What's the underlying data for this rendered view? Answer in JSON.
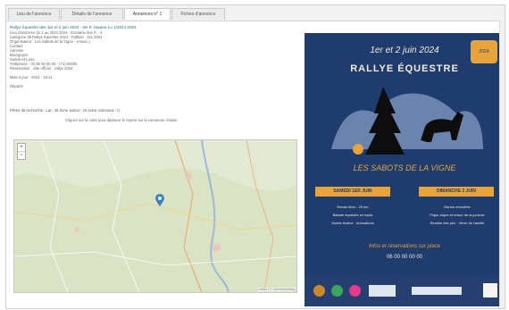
{
  "tabs": [
    {
      "label": "Lieu de l'annonce"
    },
    {
      "label": "Détails de l'annonce"
    },
    {
      "label": "Annonces n° 1"
    },
    {
      "label": "Fiches d'annonce"
    }
  ],
  "info": {
    "head": "Rallye équestre des 1er et 2 juin 2024 - les P. Hautes-Lu 1/2024 2024",
    "lines": [
      "Lieu d'annonce du 1 au 2024 2024 · Domaine des P... 4",
      "Catégorie 09 Rallye Équestre 2024 · Publiée · 111 2024",
      "Organisateur · Les Sabots de la Vigne · (Assoc.)",
      "Contact",
      "Adresse",
      "       Bourgogne",
      "       Saône-et-Loire",
      "Téléphone · 03 85 00 00 00 · (71) 00000",
      "Réservation · Site officiel · rallye 2024",
      "",
      "Mise à jour · 2024 · 18:11"
    ],
    "extra": "Départs"
  },
  "params": {
    "text": "Filtres de recherche :  Lat : 46    Zone autour : 10    Autre commune : 0"
  },
  "note": {
    "text": "Cliquez sur la carte pour déplacer le repère sur la commune choisie"
  },
  "map": {
    "zoom_in": "+",
    "zoom_out": "−",
    "attribution": "Leaflet | © OpenStreetMap"
  },
  "poster": {
    "date_line": "1er et 2 juin 2024",
    "title": "RALLYE ÉQUESTRE",
    "badge": "2024",
    "name": "LES SABOTS DE LA VIGNE",
    "day1": "SAMEDI 1ER JUIN",
    "day2": "DIMANCHE 2 JUIN",
    "d1a": "Rando libre - 25 km",
    "d1b": "Balade équestre et repas",
    "d1c": "Soirée festive · Animations",
    "d2a": "Rando encadrée",
    "d2b": "Pique-nique et retour de la journée",
    "d2c": "Remise des prix · Verre de l'amitié",
    "footer": "Infos et réservations sur place",
    "phone": "06 00 00 00 00",
    "colors": {
      "bg": "#1f3c6e",
      "accent": "#e8a33a",
      "text": "#f2eadb"
    }
  }
}
